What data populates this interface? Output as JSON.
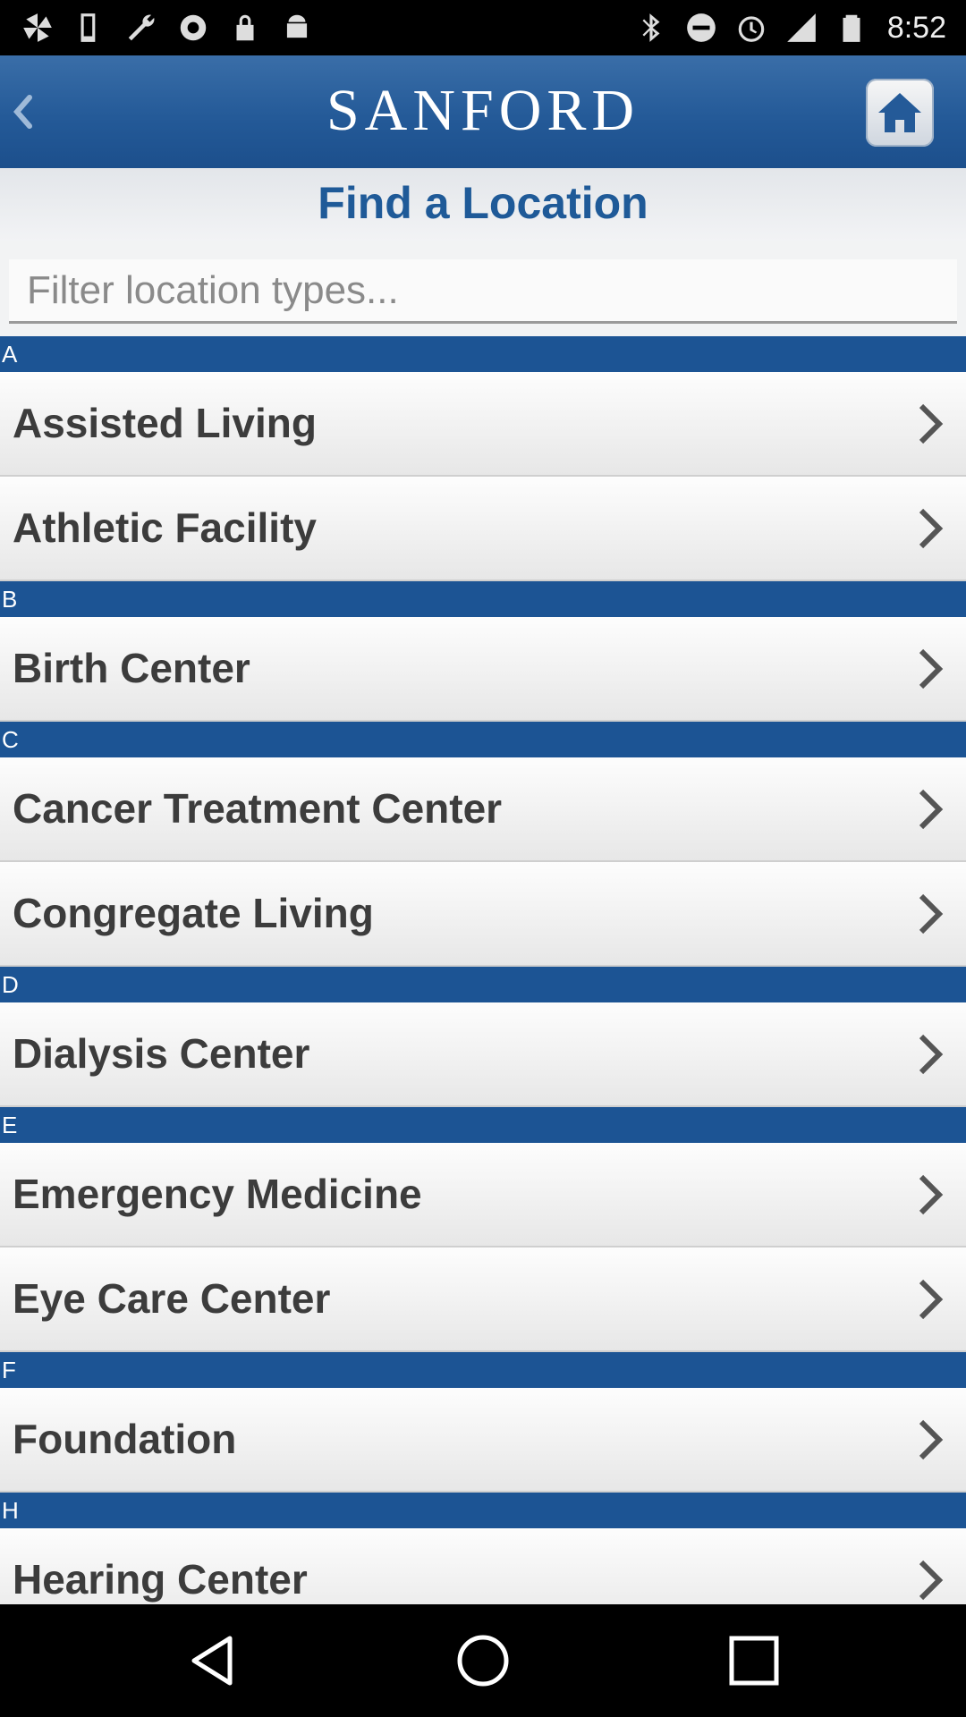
{
  "status_bar": {
    "time": "8:52",
    "left_icons": [
      "pinwheel-icon",
      "phone-icon",
      "wrench-icon",
      "settings-icon",
      "lock-icon",
      "android-icon"
    ],
    "right_icons": [
      "bluetooth-icon",
      "do-not-disturb-icon",
      "alarm-icon",
      "signal-icon",
      "battery-icon"
    ]
  },
  "header": {
    "logo_text": "SANFORD",
    "back_icon": "back-chevron-icon",
    "home_icon": "home-icon"
  },
  "page": {
    "title": "Find a Location"
  },
  "search": {
    "placeholder": "Filter location types..."
  },
  "sections": [
    {
      "letter": "A",
      "items": [
        "Assisted Living",
        "Athletic Facility"
      ]
    },
    {
      "letter": "B",
      "items": [
        "Birth Center"
      ]
    },
    {
      "letter": "C",
      "items": [
        "Cancer Treatment Center",
        "Congregate Living"
      ]
    },
    {
      "letter": "D",
      "items": [
        "Dialysis Center"
      ]
    },
    {
      "letter": "E",
      "items": [
        "Emergency Medicine",
        "Eye Care Center"
      ]
    },
    {
      "letter": "F",
      "items": [
        "Foundation"
      ]
    },
    {
      "letter": "H",
      "items": [
        "Hearing Center"
      ]
    }
  ],
  "colors": {
    "header_blue": "#245a98",
    "section_blue": "#1c5494",
    "title_blue": "#1f5a98"
  },
  "nav_bar": {
    "icons": [
      "back-triangle-icon",
      "home-circle-icon",
      "recents-square-icon"
    ]
  }
}
